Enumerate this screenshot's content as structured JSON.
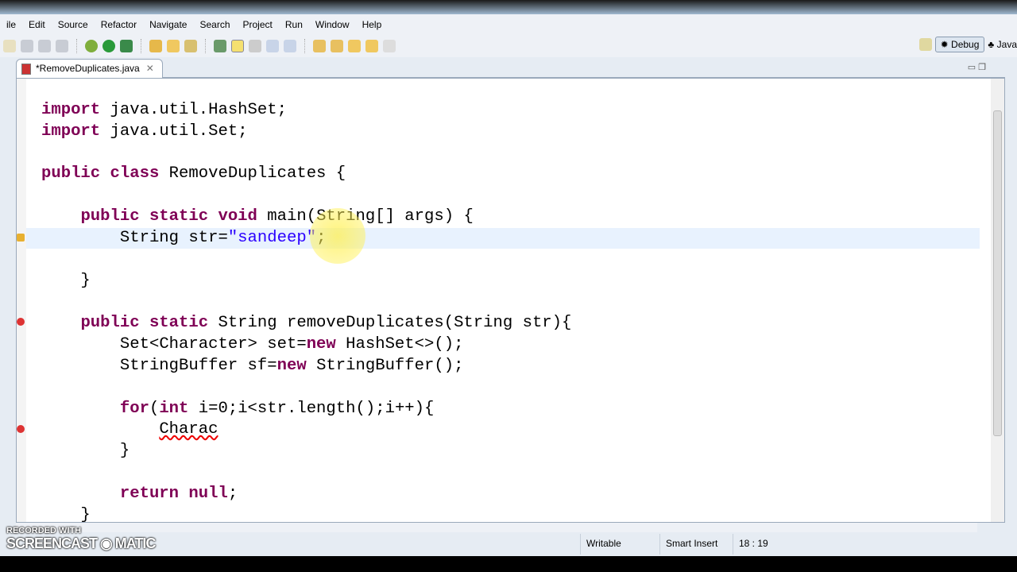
{
  "menu": [
    "ile",
    "Edit",
    "Source",
    "Refactor",
    "Navigate",
    "Search",
    "Project",
    "Run",
    "Window",
    "Help"
  ],
  "perspectives": {
    "debug": "Debug",
    "java": "Java"
  },
  "tab": {
    "title": "*RemoveDuplicates.java",
    "close": "✕"
  },
  "code_lines": [
    "import java.util.HashSet;",
    "import java.util.Set;",
    "",
    "public class RemoveDuplicates {",
    "",
    "    public static void main(String[] args) {",
    "        String str=\"sandeep\";",
    "",
    "    }",
    "",
    "    public static String removeDuplicates(String str){",
    "        Set<Character> set=new HashSet<>();",
    "        StringBuffer sf=new StringBuffer();",
    "",
    "        for(int i=0;i<str.length();i++){",
    "            Charac",
    "        }",
    "",
    "        return null;",
    "    }"
  ],
  "current_line": 6,
  "error_line": 15,
  "status": {
    "writable": "Writable",
    "insert_mode": "Smart Insert",
    "position": "18 : 19"
  },
  "watermark": {
    "line1": "RECORDED WITH",
    "line2": "SCREENCAST",
    "line3": "MATIC"
  },
  "colors": {
    "keyword": "#7f0055",
    "string": "#2a00ff",
    "current_line": "#e8f2fe"
  }
}
